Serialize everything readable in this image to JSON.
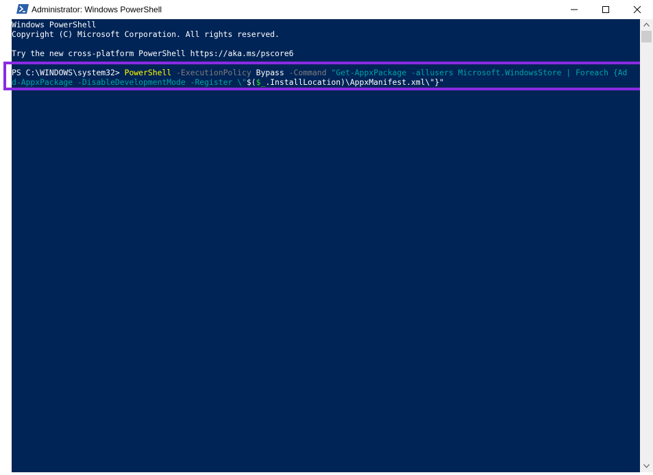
{
  "window": {
    "title": "Administrator: Windows PowerShell",
    "icon": "powershell-icon"
  },
  "controls": {
    "minimize_icon": "minimize-icon",
    "maximize_icon": "maximize-icon",
    "close_icon": "close-icon"
  },
  "console": {
    "banner_line1": "Windows PowerShell",
    "banner_line2": "Copyright (C) Microsoft Corporation. All rights reserved.",
    "banner_line3": "Try the new cross-platform PowerShell https://aka.ms/pscore6",
    "cmd_line1": {
      "prompt": "PS C:\\WINDOWS\\system32> ",
      "command": "PowerShell",
      "sp1": " ",
      "param1": "-ExecutionPolicy",
      "sp2": " ",
      "arg1": "Bypass",
      "sp3": " ",
      "param2": "-Command",
      "sp4": " ",
      "string1": "\"Get-AppxPackage -allusers Microsoft.WindowsStore | Foreach {Ad"
    },
    "cmd_line2": {
      "string2": "d-AppxPackage -DisableDevelopmentMode -Register \\\"",
      "sub_open": "$(",
      "variable": "$_",
      "sub_rest": ".InstallLocation)\\AppxManifest.xml\\\"}\""
    }
  },
  "colors": {
    "console_background": "#012456",
    "highlight_border": "#8a2be2",
    "command": "#ffff00",
    "parameter": "#7f7f7f",
    "string": "#00a3a3",
    "variable": "#2ee72e"
  }
}
